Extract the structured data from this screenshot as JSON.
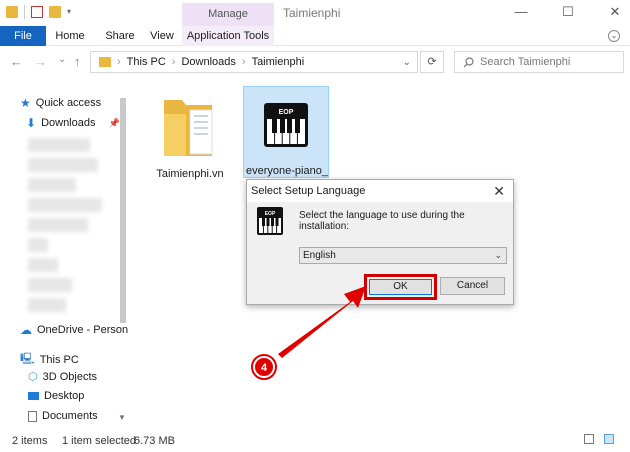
{
  "window": {
    "context_tab": "Manage",
    "title": "Taimienphi",
    "minimize": "—",
    "maximize": "☐",
    "close": "✕"
  },
  "ribbon": {
    "tabs": [
      "File",
      "Home",
      "Share",
      "View",
      "Application Tools"
    ]
  },
  "address": {
    "back": "←",
    "forward": "→",
    "history": "⌄",
    "up": "↑",
    "crumbs": [
      "This PC",
      "Downloads",
      "Taimienphi"
    ],
    "sep": "›",
    "refresh": "⟳",
    "search_placeholder": "Search Taimienphi"
  },
  "nav": {
    "quick_access": "Quick access",
    "downloads": "Downloads",
    "onedrive": "OneDrive - Person",
    "this_pc": "This PC",
    "objects3d": "3D Objects",
    "desktop": "Desktop",
    "documents": "Documents"
  },
  "files": [
    {
      "name": "Taimienphi.vn",
      "type": "folder"
    },
    {
      "name": "everyone-piano_",
      "type": "installer",
      "icon_text": "EOP"
    }
  ],
  "dialog": {
    "title": "Select Setup Language",
    "close": "✕",
    "message": "Select the language to use during the installation:",
    "icon_text": "EOP",
    "selected_language": "English",
    "ok_label": "OK",
    "cancel_label": "Cancel"
  },
  "annotation": {
    "step_number": "4"
  },
  "status": {
    "items": "2 items",
    "selected": "1 item selected",
    "size": "6.73 MB"
  },
  "colors": {
    "file_tab": "#1565c0",
    "manage_tab": "#eee0f5",
    "highlight": "#d00000",
    "folder": "#e9b640",
    "selection": "#cce4f7"
  }
}
